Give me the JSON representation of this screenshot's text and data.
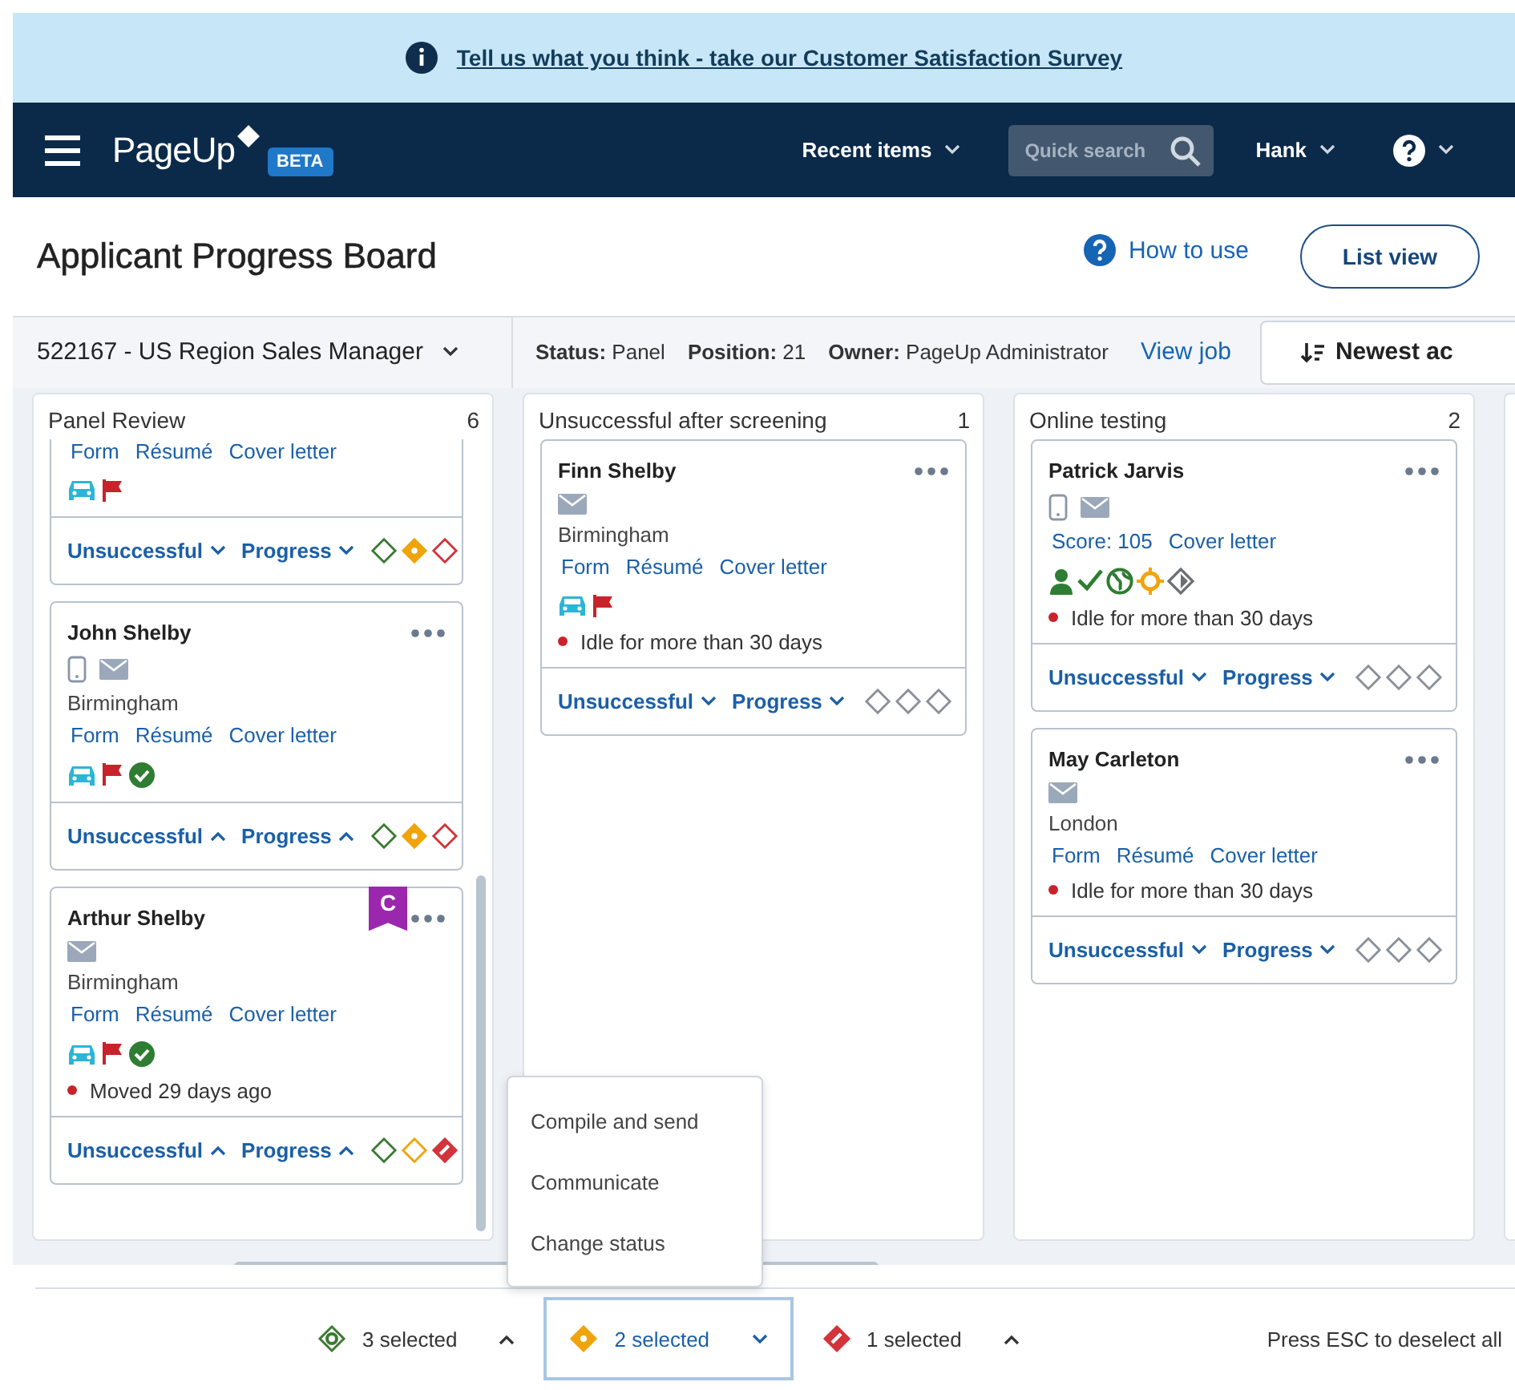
{
  "banner": {
    "text": "Tell us what you think - take our Customer Satisfaction Survey"
  },
  "nav": {
    "logo": "PageUp",
    "beta": "BETA",
    "recent": "Recent items",
    "search_placeholder": "Quick search",
    "user": "Hank"
  },
  "header": {
    "title": "Applicant Progress Board",
    "how_to_use": "How to use",
    "list_view": "List view"
  },
  "job": {
    "title": "522167 - US Region Sales Manager",
    "fields": [
      {
        "label": "Status:",
        "value": "Panel"
      },
      {
        "label": "Position:",
        "value": "21"
      },
      {
        "label": "Owner:",
        "value": "PageUp Administrator"
      }
    ],
    "view_job": "View job",
    "sort": "Newest ac"
  },
  "columns": [
    {
      "title": "Panel Review",
      "count": "6",
      "cards": [
        {
          "clipped": true,
          "links": [
            "Form",
            "Résumé",
            "Cover letter"
          ],
          "badges": [
            {
              "kind": "car"
            },
            {
              "kind": "flag"
            }
          ],
          "footer": {
            "unsuccessful": "Unsuccessful",
            "unsuccessful_expanded": false,
            "progress": "Progress",
            "progress_expanded": false
          },
          "marks": [
            {
              "kind": "ring",
              "color": "#3d7a34",
              "selected": false
            },
            {
              "kind": "dot",
              "color": "#f0a40c",
              "selected": true
            },
            {
              "kind": "stripe",
              "color": "#d1343a",
              "selected": false
            }
          ]
        },
        {
          "name": "John Shelby",
          "contacts": [
            {
              "kind": "phone"
            },
            {
              "kind": "mail"
            }
          ],
          "location": "Birmingham",
          "links": [
            "Form",
            "Résumé",
            "Cover letter"
          ],
          "badges": [
            {
              "kind": "car"
            },
            {
              "kind": "flag"
            },
            {
              "kind": "check-circle"
            }
          ],
          "footer": {
            "unsuccessful": "Unsuccessful",
            "unsuccessful_expanded": true,
            "progress": "Progress",
            "progress_expanded": true
          },
          "marks": [
            {
              "kind": "ring",
              "color": "#3d7a34",
              "selected": false
            },
            {
              "kind": "dot",
              "color": "#f0a40c",
              "selected": true
            },
            {
              "kind": "stripe",
              "color": "#d1343a",
              "selected": false
            }
          ]
        },
        {
          "name": "Arthur Shelby",
          "ribbon": "C",
          "contacts": [
            {
              "kind": "mail"
            }
          ],
          "location": "Birmingham",
          "links": [
            "Form",
            "Résumé",
            "Cover letter"
          ],
          "badges": [
            {
              "kind": "car"
            },
            {
              "kind": "flag"
            },
            {
              "kind": "check-circle"
            }
          ],
          "note": "Moved 29 days ago",
          "footer": {
            "unsuccessful": "Unsuccessful",
            "unsuccessful_expanded": true,
            "progress": "Progress",
            "progress_expanded": true
          },
          "marks": [
            {
              "kind": "ring",
              "color": "#3d7a34",
              "selected": false
            },
            {
              "kind": "dot",
              "color": "#f0a40c",
              "selected": false
            },
            {
              "kind": "stripe",
              "color": "#d1343a",
              "selected": true
            }
          ]
        }
      ]
    },
    {
      "title": "Unsuccessful after screening",
      "count": "1",
      "cards": [
        {
          "name": "Finn Shelby",
          "contacts": [
            {
              "kind": "mail"
            }
          ],
          "location": "Birmingham",
          "links": [
            "Form",
            "Résumé",
            "Cover letter"
          ],
          "badges": [
            {
              "kind": "car"
            },
            {
              "kind": "flag"
            }
          ],
          "note": "Idle for more than 30 days",
          "footer": {
            "unsuccessful": "Unsuccessful",
            "unsuccessful_expanded": false,
            "progress": "Progress",
            "progress_expanded": false
          },
          "marks": [
            {
              "kind": "ring",
              "color": "#8a9099",
              "selected": false
            },
            {
              "kind": "dot",
              "color": "#8a9099",
              "selected": false
            },
            {
              "kind": "stripe",
              "color": "#8a9099",
              "selected": false
            }
          ]
        }
      ]
    },
    {
      "title": "Online testing",
      "count": "2",
      "cards": [
        {
          "name": "Patrick Jarvis",
          "contacts": [
            {
              "kind": "phone"
            },
            {
              "kind": "mail"
            }
          ],
          "links": [
            "Score: 105",
            "Cover letter"
          ],
          "badges": [
            {
              "kind": "person"
            },
            {
              "kind": "check"
            },
            {
              "kind": "globe"
            },
            {
              "kind": "sun"
            },
            {
              "kind": "diamond"
            }
          ],
          "note": "Idle for more than 30 days",
          "footer": {
            "unsuccessful": "Unsuccessful",
            "unsuccessful_expanded": false,
            "progress": "Progress",
            "progress_expanded": false
          },
          "marks": [
            {
              "kind": "ring",
              "color": "#8a9099",
              "selected": false
            },
            {
              "kind": "dot",
              "color": "#8a9099",
              "selected": false
            },
            {
              "kind": "stripe",
              "color": "#8a9099",
              "selected": false
            }
          ]
        },
        {
          "name": "May Carleton",
          "contacts": [
            {
              "kind": "mail"
            }
          ],
          "location": "London",
          "links": [
            "Form",
            "Résumé",
            "Cover letter"
          ],
          "note": "Idle for more than 30 days",
          "footer": {
            "unsuccessful": "Unsuccessful",
            "unsuccessful_expanded": false,
            "progress": "Progress",
            "progress_expanded": false
          },
          "marks": [
            {
              "kind": "ring",
              "color": "#8a9099",
              "selected": false
            },
            {
              "kind": "dot",
              "color": "#8a9099",
              "selected": false
            },
            {
              "kind": "stripe",
              "color": "#8a9099",
              "selected": false
            }
          ]
        }
      ]
    }
  ],
  "selection": {
    "groups": [
      {
        "kind": "ring",
        "color": "#3d7a34",
        "label": "3 selected",
        "selected": false
      },
      {
        "kind": "dot",
        "color": "#f0a40c",
        "label": "2 selected",
        "selected": true
      },
      {
        "kind": "stripe",
        "color": "#d1343a",
        "label": "1 selected",
        "selected": false
      }
    ],
    "menu": [
      "Compile and send",
      "Communicate",
      "Change status"
    ],
    "hint": "Press ESC to deselect all"
  }
}
